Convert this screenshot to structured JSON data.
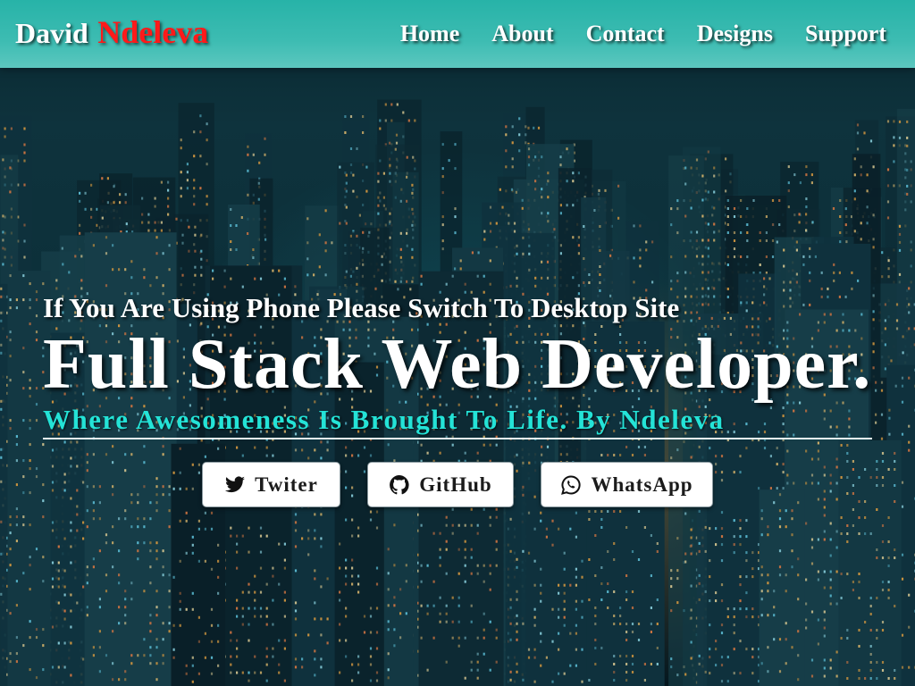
{
  "brand": {
    "first_name": "David",
    "last_name": "Ndeleva"
  },
  "nav": {
    "items": [
      {
        "label": "Home"
      },
      {
        "label": "About"
      },
      {
        "label": "Contact"
      },
      {
        "label": "Designs"
      },
      {
        "label": "Support"
      }
    ]
  },
  "hero": {
    "notice": "If You Are Using Phone Please Switch To Desktop Site",
    "headline": "Full Stack Web Developer.",
    "tagline": "Where Awesomeness Is Brought To Life. By Ndeleva",
    "background_icon": "night-city-skyline"
  },
  "social": {
    "buttons": [
      {
        "label": "Twiter",
        "icon": "twitter-icon"
      },
      {
        "label": "GitHub",
        "icon": "github-icon"
      },
      {
        "label": "WhatsApp",
        "icon": "whatsapp-icon"
      }
    ]
  },
  "colors": {
    "navbar": "#3dbcb2",
    "brand_last_name": "#ff1a1a",
    "tagline": "#24e3d7",
    "button_bg": "#ffffff"
  }
}
